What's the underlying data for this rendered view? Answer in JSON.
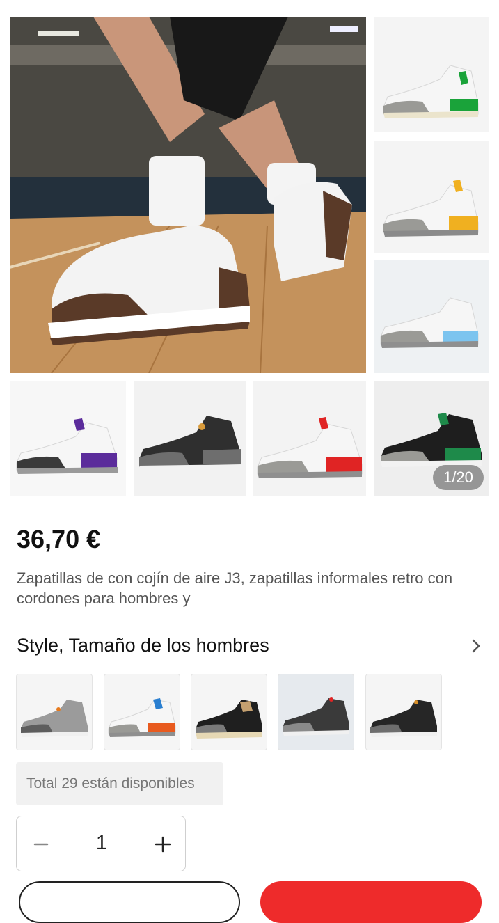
{
  "gallery": {
    "counter": "1/20",
    "images": [
      {
        "id": "main",
        "desc": "hero-basketball-shoe",
        "sole": "#5a3a28"
      },
      {
        "id": "t1",
        "accent": "#1aa33a"
      },
      {
        "id": "t2",
        "accent": "#f0b020"
      },
      {
        "id": "t3",
        "accent": "#7cc4ef"
      },
      {
        "id": "b1",
        "accent": "#5b2c9b"
      },
      {
        "id": "b2",
        "accent": "#2d2d2d"
      },
      {
        "id": "b3",
        "accent": "#e02424"
      },
      {
        "id": "b4",
        "accent": "#1e8a4a"
      }
    ]
  },
  "product": {
    "price": "36,70 €",
    "title": "Zapatillas de con cojín de aire J3, zapatillas informales retro con cordones para hombres y"
  },
  "variants": {
    "section_title": "Style, Tamaño de los hombres",
    "options": [
      {
        "name": "grey-orange"
      },
      {
        "name": "white-orange-blue"
      },
      {
        "name": "black-cream"
      },
      {
        "name": "grey-black-red"
      },
      {
        "name": "black-grey"
      }
    ]
  },
  "stock": {
    "availability": "Total 29 están disponibles"
  },
  "quantity": {
    "value": "1",
    "minus_icon": "minus-icon",
    "plus_icon": "plus-icon"
  },
  "colors": {
    "accent_red": "#ee2b2b",
    "text_dark": "#111111",
    "text_muted": "#555555"
  }
}
